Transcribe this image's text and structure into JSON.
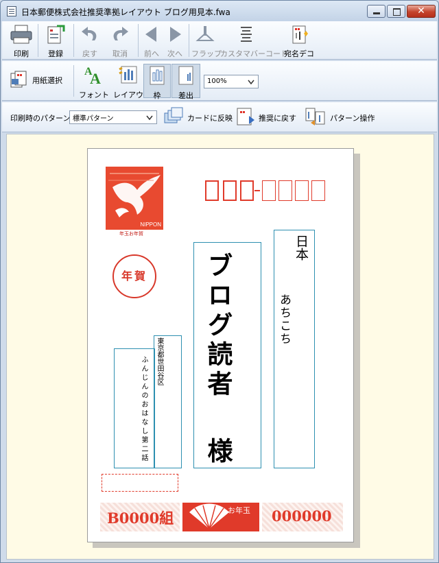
{
  "window": {
    "title": "日本郵便株式会社推奨準拠レイアウト  ブログ用見本.fwa"
  },
  "toolbar1": {
    "print": "印刷",
    "register": "登録",
    "undo": "戻す",
    "redo": "取消",
    "prev": "前へ",
    "next": "次へ",
    "flap": "フラップ",
    "custom_barcode": "カスタマバーコード",
    "address_deco": "宛名デコ"
  },
  "toolbar2": {
    "paper_select": "用紙選択",
    "font": "フォント",
    "layout": "レイアウト",
    "frame": "枠",
    "sender": "差出",
    "zoom": "100%"
  },
  "toolbar3": {
    "pattern_label": "印刷時のパターン",
    "pattern_value": "標準パターン",
    "apply_card": "カードに反映",
    "restore": "推奨に戻す",
    "pattern_ops": "パターン操作"
  },
  "card": {
    "stamp_brand": "NIPPON",
    "stamp_caption": "年玉お年賀",
    "nenga": "年賀",
    "recipient_address": "日本",
    "recipient_address2": "あちこち",
    "recipient_name": "ブログ読者",
    "honorific": "様",
    "sender_address": "東京都世田谷区",
    "sender_name": "ふんじんのおはなし第二話",
    "lottery_group": "B0000組",
    "lottery_tag": "お年玉",
    "lottery_number": "000000"
  },
  "colors": {
    "postal_red": "#e03a2a",
    "frame_blue": "#2c8fb0",
    "paper": "#fffbe6"
  }
}
